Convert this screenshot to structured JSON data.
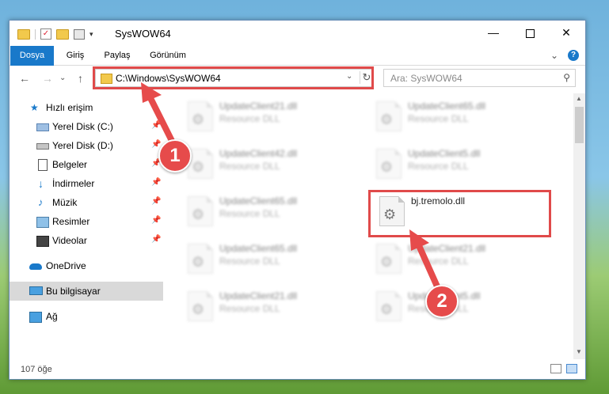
{
  "window": {
    "title": "SysWOW64",
    "min_glyph": "—",
    "close_glyph": "✕"
  },
  "quick_access_toolbar": {
    "dropdown_glyph": "▾"
  },
  "ribbon": {
    "tabs": [
      {
        "label": "Dosya"
      },
      {
        "label": "Giriş"
      },
      {
        "label": "Paylaş"
      },
      {
        "label": "Görünüm"
      }
    ],
    "expand_glyph": "⌄",
    "help_glyph": "?"
  },
  "navigation": {
    "back_glyph": "←",
    "forward_glyph": "→",
    "recent_glyph": "⌄",
    "up_glyph": "↑"
  },
  "address_bar": {
    "path": "C:\\Windows\\SysWOW64",
    "dropdown_glyph": "⌄",
    "refresh_glyph": "↻"
  },
  "search": {
    "placeholder": "Ara: SysWOW64",
    "icon_glyph": "⚲"
  },
  "sidebar": {
    "pin_glyph": "📌",
    "items": [
      {
        "label": "Hızlı erişim",
        "icon": "star-icon"
      },
      {
        "label": "Yerel Disk (C:)",
        "icon": "drive-c-icon"
      },
      {
        "label": "Yerel Disk (D:)",
        "icon": "drive-d-icon"
      },
      {
        "label": "Belgeler",
        "icon": "document-icon"
      },
      {
        "label": "İndirmeler",
        "icon": "download-icon"
      },
      {
        "label": "Müzik",
        "icon": "music-icon"
      },
      {
        "label": "Resimler",
        "icon": "picture-icon"
      },
      {
        "label": "Videolar",
        "icon": "video-icon"
      },
      {
        "label": "OneDrive",
        "icon": "cloud-icon"
      },
      {
        "label": "Bu bilgisayar",
        "icon": "computer-icon",
        "selected": true
      },
      {
        "label": "Ağ",
        "icon": "network-icon"
      }
    ]
  },
  "files": [
    {
      "name": "UpdateClient21.dll",
      "type": "Resource DLL"
    },
    {
      "name": "UpdateClient65.dll",
      "type": "Resource DLL"
    },
    {
      "name": "UpdateClient42.dll",
      "type": "Resource DLL"
    },
    {
      "name": "UpdateClient5.dll",
      "type": "Resource DLL"
    },
    {
      "name": "UpdateClient65.dll",
      "type": "Resource DLL"
    },
    {
      "name": "bj.tremolo.dll",
      "type": "",
      "highlighted": true
    },
    {
      "name": "UpdateClient65.dll",
      "type": "Resource DLL"
    },
    {
      "name": "UpdateClient21.dll",
      "type": "Resource DLL"
    },
    {
      "name": "UpdateClient21.dll",
      "type": "Resource DLL"
    },
    {
      "name": "UpdateClient5.dll",
      "type": "Resource DLL"
    }
  ],
  "status_bar": {
    "item_count": "107 öğe"
  },
  "annotations": {
    "step1": "1",
    "step2": "2",
    "highlight_color": "#e04a4a"
  }
}
